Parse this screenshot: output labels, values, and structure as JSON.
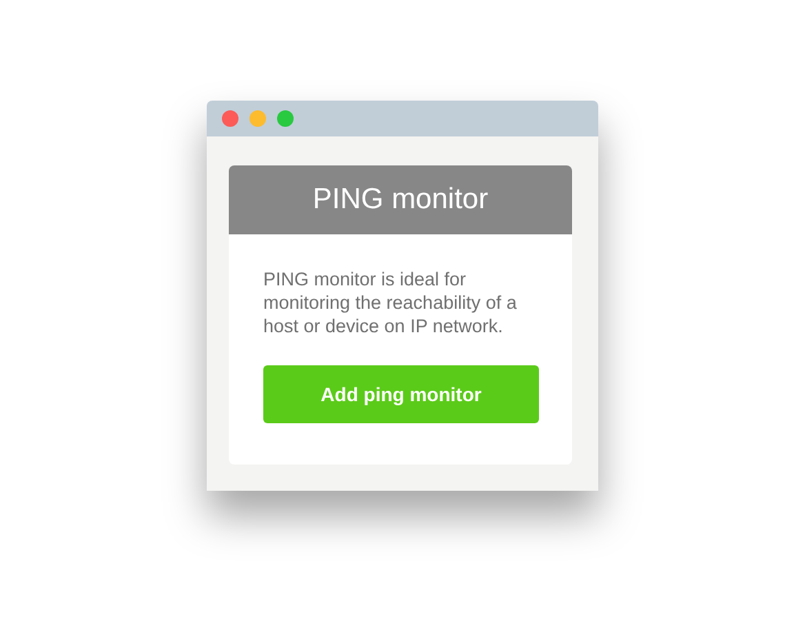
{
  "card": {
    "title": "PING monitor",
    "description": "PING monitor is ideal for monitoring the reachability of a host or device on IP network.",
    "button": "Add ping monitor"
  }
}
